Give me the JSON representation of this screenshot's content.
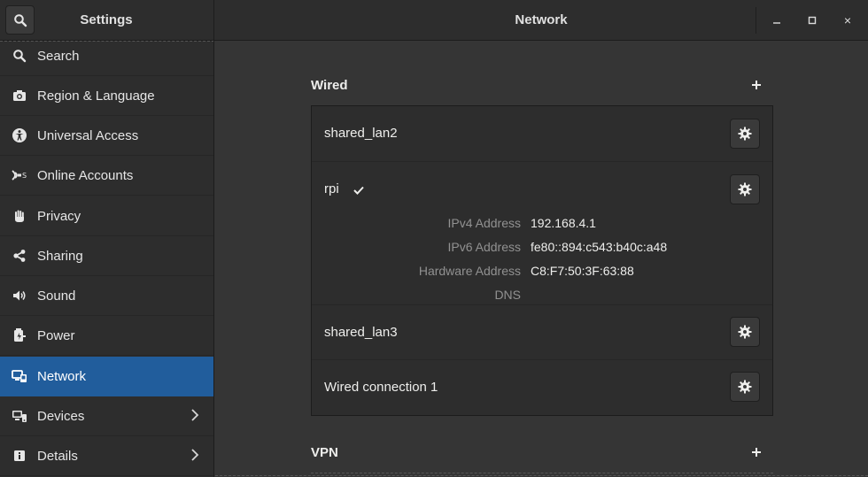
{
  "header": {
    "sidebar_title": "Settings",
    "main_title": "Network",
    "search_icon": "search-icon",
    "window_controls": [
      "minimize-icon",
      "maximize-icon",
      "close-icon"
    ],
    "close_glyph": "×"
  },
  "sidebar": {
    "items": [
      {
        "label": "Search",
        "icon": "search-icon"
      },
      {
        "label": "Region & Language",
        "icon": "camera-icon"
      },
      {
        "label": "Universal Access",
        "icon": "accessibility-icon"
      },
      {
        "label": "Online Accounts",
        "icon": "online-accounts-icon"
      },
      {
        "label": "Privacy",
        "icon": "hand-icon"
      },
      {
        "label": "Sharing",
        "icon": "share-icon"
      },
      {
        "label": "Sound",
        "icon": "speaker-icon"
      },
      {
        "label": "Power",
        "icon": "plug-icon"
      },
      {
        "label": "Network",
        "icon": "network-icon",
        "active": true
      },
      {
        "label": "Devices",
        "icon": "devices-icon",
        "has_submenu": true
      },
      {
        "label": "Details",
        "icon": "info-icon",
        "has_submenu": true
      }
    ]
  },
  "wired": {
    "title": "Wired",
    "add_icon": "plus-icon",
    "connections": [
      {
        "name": "shared_lan2"
      },
      {
        "name": "rpi",
        "connected": true,
        "details": [
          {
            "label": "IPv4 Address",
            "value": "192.168.4.1"
          },
          {
            "label": "IPv6 Address",
            "value": "fe80::894:c543:b40c:a48"
          },
          {
            "label": "Hardware Address",
            "value": "C8:F7:50:3F:63:88"
          },
          {
            "label": "DNS",
            "value": ""
          }
        ]
      },
      {
        "name": "shared_lan3"
      },
      {
        "name": "Wired connection 1"
      }
    ]
  },
  "vpn": {
    "title": "VPN",
    "add_icon": "plus-icon"
  },
  "colors": {
    "accent": "#215d9c",
    "background": "#353535",
    "sidebar": "#2d2d2d"
  }
}
